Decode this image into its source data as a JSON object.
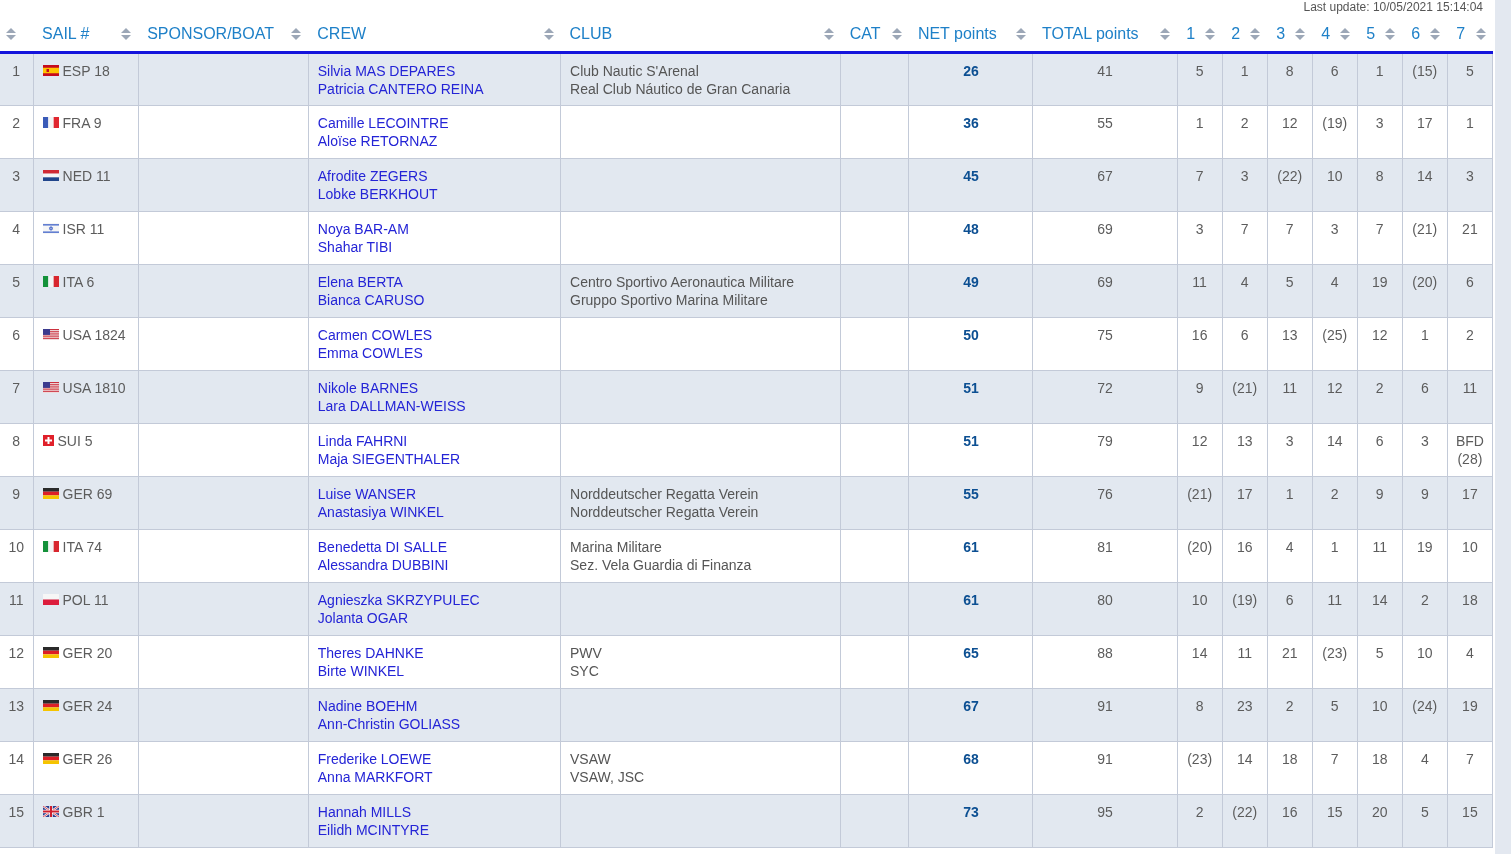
{
  "last_update": "Last update: 10/05/2021 15:14:04",
  "table": {
    "columns": [
      {
        "sortable": true
      },
      {
        "label": "SAIL #",
        "sortable": true
      },
      {
        "label": "SPONSOR/BOAT",
        "sortable": true
      },
      {
        "label": "CREW",
        "sortable": true
      },
      {
        "label": "CLUB",
        "sortable": true
      },
      {
        "label": "CAT",
        "sortable": true
      },
      {
        "label": "NET points",
        "sortable": true
      },
      {
        "label": "TOTAL points",
        "sortable": true
      },
      {
        "label": "1",
        "sortable": true
      },
      {
        "label": "2",
        "sortable": true
      },
      {
        "label": "3",
        "sortable": true
      },
      {
        "label": "4",
        "sortable": true
      },
      {
        "label": "5",
        "sortable": true
      },
      {
        "label": "6",
        "sortable": true
      },
      {
        "label": "7",
        "sortable": true
      }
    ],
    "rows": [
      {
        "rank": "1",
        "flag": {
          "kind": "spain"
        },
        "sail": "ESP 18",
        "crew": [
          "Silvia MAS DEPARES",
          "Patricia CANTERO REINA"
        ],
        "club": [
          "Club Nautic S'Arenal",
          "Real Club Náutico de Gran Canaria"
        ],
        "net": "26",
        "total": "41",
        "races": [
          "5",
          "1",
          "8",
          "6",
          "1",
          "(15)",
          "5"
        ]
      },
      {
        "rank": "2",
        "flag": {
          "kind": "france"
        },
        "sail": "FRA 9",
        "crew": [
          "Camille LECOINTRE",
          "Aloïse RETORNAZ"
        ],
        "net": "36",
        "total": "55",
        "races": [
          "1",
          "2",
          "12",
          "(19)",
          "3",
          "17",
          "1"
        ]
      },
      {
        "rank": "3",
        "flag": {
          "kind": "netherlands"
        },
        "sail": "NED 11",
        "crew": [
          "Afrodite ZEGERS",
          "Lobke BERKHOUT"
        ],
        "net": "45",
        "total": "67",
        "races": [
          "7",
          "3",
          "(22)",
          "10",
          "8",
          "14",
          "3"
        ]
      },
      {
        "rank": "4",
        "flag": {
          "kind": "israel"
        },
        "sail": "ISR 11",
        "crew": [
          "Noya BAR-AM",
          "Shahar TIBI"
        ],
        "net": "48",
        "total": "69",
        "races": [
          "3",
          "7",
          "7",
          "3",
          "7",
          "(21)",
          "21"
        ]
      },
      {
        "rank": "5",
        "flag": {
          "kind": "italy"
        },
        "sail": "ITA 6",
        "crew": [
          "Elena BERTA",
          "Bianca CARUSO"
        ],
        "club": [
          "Centro Sportivo Aeronautica Militare",
          "Gruppo Sportivo Marina Militare"
        ],
        "net": "49",
        "total": "69",
        "races": [
          "11",
          "4",
          "5",
          "4",
          "19",
          "(20)",
          "6"
        ]
      },
      {
        "rank": "6",
        "flag": {
          "kind": "usa"
        },
        "sail": "USA 1824",
        "crew": [
          "Carmen COWLES",
          "Emma COWLES"
        ],
        "net": "50",
        "total": "75",
        "races": [
          "16",
          "6",
          "13",
          "(25)",
          "12",
          "1",
          "2"
        ]
      },
      {
        "rank": "7",
        "flag": {
          "kind": "usa"
        },
        "sail": "USA 1810",
        "crew": [
          "Nikole BARNES",
          "Lara DALLMAN-WEISS"
        ],
        "net": "51",
        "total": "72",
        "races": [
          "9",
          "(21)",
          "11",
          "12",
          "2",
          "6",
          "11"
        ]
      },
      {
        "rank": "8",
        "flag": {
          "kind": "switzerland"
        },
        "sail": "SUI 5",
        "crew": [
          "Linda FAHRNI",
          "Maja SIEGENTHALER"
        ],
        "net": "51",
        "total": "79",
        "races": [
          "12",
          "13",
          "3",
          "14",
          "6",
          "3",
          "BFD (28)"
        ]
      },
      {
        "rank": "9",
        "flag": {
          "kind": "germany"
        },
        "sail": "GER 69",
        "crew": [
          "Luise WANSER",
          "Anastasiya WINKEL"
        ],
        "club": [
          "Norddeutscher Regatta Verein",
          "Norddeutscher Regatta Verein"
        ],
        "net": "55",
        "total": "76",
        "races": [
          "(21)",
          "17",
          "1",
          "2",
          "9",
          "9",
          "17"
        ]
      },
      {
        "rank": "10",
        "flag": {
          "kind": "italy"
        },
        "sail": "ITA 74",
        "crew": [
          "Benedetta DI SALLE",
          "Alessandra DUBBINI"
        ],
        "club": [
          "Marina Militare",
          "Sez. Vela Guardia di Finanza"
        ],
        "net": "61",
        "total": "81",
        "races": [
          "(20)",
          "16",
          "4",
          "1",
          "11",
          "19",
          "10"
        ]
      },
      {
        "rank": "11",
        "flag": {
          "kind": "poland"
        },
        "sail": "POL 11",
        "crew": [
          "Agnieszka SKRZYPULEC",
          "Jolanta OGAR"
        ],
        "net": "61",
        "total": "80",
        "races": [
          "10",
          "(19)",
          "6",
          "11",
          "14",
          "2",
          "18"
        ]
      },
      {
        "rank": "12",
        "flag": {
          "kind": "germany"
        },
        "sail": "GER 20",
        "crew": [
          "Theres DAHNKE",
          "Birte WINKEL"
        ],
        "club": [
          "PWV",
          "SYC"
        ],
        "net": "65",
        "total": "88",
        "races": [
          "14",
          "11",
          "21",
          "(23)",
          "5",
          "10",
          "4"
        ]
      },
      {
        "rank": "13",
        "flag": {
          "kind": "germany"
        },
        "sail": "GER 24",
        "crew": [
          "Nadine BOEHM",
          "Ann-Christin GOLIASS"
        ],
        "net": "67",
        "total": "91",
        "races": [
          "8",
          "23",
          "2",
          "5",
          "10",
          "(24)",
          "19"
        ]
      },
      {
        "rank": "14",
        "flag": {
          "kind": "germany"
        },
        "sail": "GER 26",
        "crew": [
          "Frederike LOEWE",
          "Anna MARKFORT"
        ],
        "club": [
          "VSAW",
          "VSAW, JSC"
        ],
        "net": "68",
        "total": "91",
        "races": [
          "(23)",
          "14",
          "18",
          "7",
          "18",
          "4",
          "7"
        ]
      },
      {
        "rank": "15",
        "flag": {
          "kind": "uk"
        },
        "sail": "GBR 1",
        "crew": [
          "Hannah MILLS",
          "Eilidh MCINTYRE"
        ],
        "net": "73",
        "total": "95",
        "races": [
          "2",
          "(22)",
          "16",
          "15",
          "20",
          "5",
          "15"
        ]
      }
    ]
  }
}
